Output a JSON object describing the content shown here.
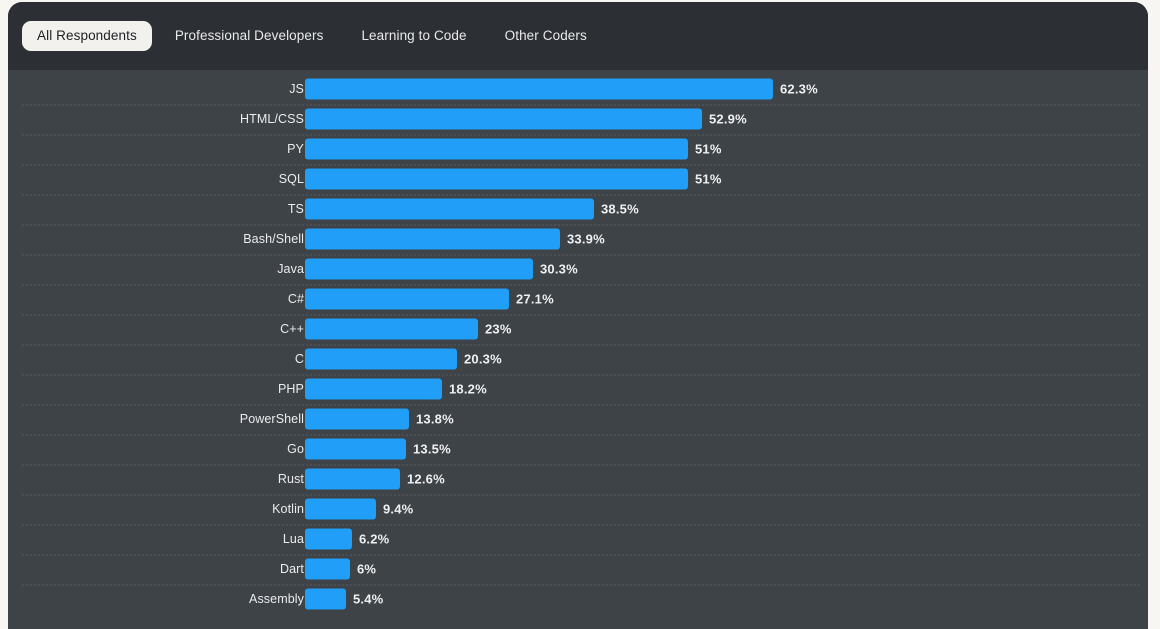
{
  "tabs": [
    {
      "label": "All Respondents",
      "active": true
    },
    {
      "label": "Professional Developers",
      "active": false
    },
    {
      "label": "Learning to Code",
      "active": false
    },
    {
      "label": "Other Coders",
      "active": false
    }
  ],
  "colors": {
    "bar": "#219ef7",
    "panel_background": "#3e4347",
    "tabbar_background": "#2c3034",
    "active_tab_background": "#f2f1ee",
    "active_tab_text": "#1d2023",
    "tab_text": "#e9e9ea",
    "gridline": "#4a4f54",
    "page_background": "#f7f6f3"
  },
  "chart_data": {
    "type": "bar",
    "orientation": "horizontal",
    "title": "",
    "xlabel": "",
    "ylabel": "",
    "xlim": [
      0,
      65
    ],
    "grid": "horizontal-dotted",
    "legend": "none",
    "value_suffix": "%",
    "categories": [
      "JS",
      "HTML/CSS",
      "PY",
      "SQL",
      "TS",
      "Bash/Shell",
      "Java",
      "C#",
      "C++",
      "C",
      "PHP",
      "PowerShell",
      "Go",
      "Rust",
      "Kotlin",
      "Lua",
      "Dart",
      "Assembly"
    ],
    "values": [
      62.3,
      52.9,
      51,
      51,
      38.5,
      33.9,
      30.3,
      27.1,
      23,
      20.3,
      18.2,
      13.8,
      13.5,
      12.6,
      9.4,
      6.2,
      6,
      5.4
    ],
    "value_labels": [
      "62.3%",
      "52.9%",
      "51%",
      "51%",
      "38.5%",
      "33.9%",
      "30.3%",
      "27.1%",
      "23%",
      "20.3%",
      "18.2%",
      "13.8%",
      "13.5%",
      "12.6%",
      "9.4%",
      "6.2%",
      "6%",
      "5.4%"
    ]
  }
}
